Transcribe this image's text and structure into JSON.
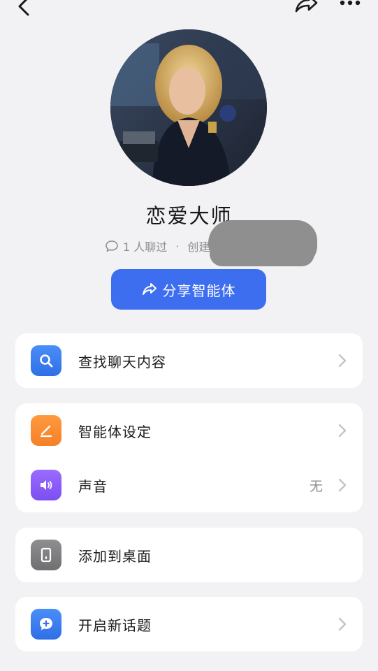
{
  "nav": {
    "back_icon": "chevron-left-icon",
    "share_icon": "share-icon",
    "more_icon": "more-dots-icon"
  },
  "agent": {
    "name": "恋爱大师",
    "chat_count": "1 人聊过",
    "separator": "·",
    "creator_prefix": "创建人"
  },
  "share_button": {
    "label": "分享智能体",
    "icon": "share-arrow-icon"
  },
  "menu": {
    "search_chat": {
      "label": "查找聊天内容",
      "icon": "search-icon"
    },
    "agent_settings": {
      "label": "智能体设定",
      "icon": "pen-icon"
    },
    "voice": {
      "label": "声音",
      "value": "无",
      "icon": "speaker-icon"
    },
    "add_to_desktop": {
      "label": "添加到桌面",
      "icon": "phone-icon"
    },
    "new_topic": {
      "label": "开启新话题",
      "icon": "chat-plus-icon"
    }
  },
  "colors": {
    "accent": "#3d6ef0",
    "background": "#f2f2f5",
    "orange_icon": "#f5802a",
    "purple_icon": "#7b4ef2",
    "gray_icon": "#6f6f72"
  }
}
